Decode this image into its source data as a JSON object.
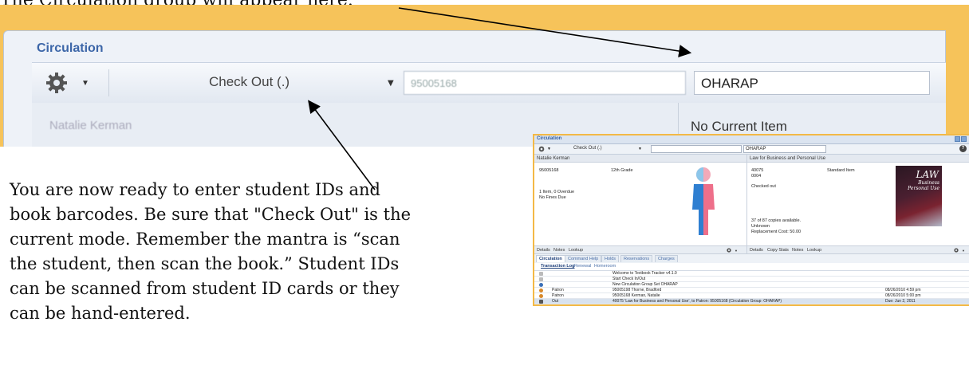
{
  "top_caption": "The Circulation group will appear here.",
  "zoom": {
    "title": "Circulation",
    "mode": "Check Out (.)",
    "barcode_value": "95005168",
    "group_value": "OHARAP",
    "patron_name": "Natalie Kerman",
    "current_item": "No Current Item"
  },
  "paragraph": [
    "You are now ready to enter student IDs and",
    "book barcodes.  Be sure that \"Check Out\" is the",
    "current mode. Remember the mantra is “scan",
    "the student, then  scan the book.” Student IDs",
    "can be scanned from student ID cards or they",
    "can be hand-entered."
  ],
  "shot": {
    "title": "Circulation",
    "mode": "Check Out (.)",
    "group_value": "OHARAP",
    "help": "?",
    "patron": {
      "name": "Natalie Kerman",
      "id": "95005168",
      "grade": "12th Grade",
      "items": "1 Item, 0 Overdue",
      "fines": "No Fines Due"
    },
    "item": {
      "title": "Law for Business and Personal Use",
      "number": "40075",
      "copy": "0004",
      "type": "Standard Item",
      "status": "Checked out",
      "copies": "37 of 87 copies available.",
      "location": "Unknown",
      "cost": "Replacement Cost: 50.00",
      "cover_title": "LAW",
      "cover_sub1": "Business",
      "cover_sub2": "Personal Use"
    },
    "patron_bar": [
      "Details",
      "Notes",
      "Lookup"
    ],
    "item_bar": [
      "Details",
      "Copy Stats",
      "Notes",
      "Lookup"
    ],
    "tabs": [
      "Circulation",
      "Command Help",
      "Holds",
      "Reservations",
      "Charges"
    ],
    "subtabs": [
      "Transaction Log",
      "Renewal",
      "Homeroom"
    ],
    "log": [
      {
        "type": "",
        "text": "Welcome to Textbook Tracker v4.1.0",
        "date": "",
        "icon": "note-icon"
      },
      {
        "type": "",
        "text": "Start Check In/Out",
        "date": "",
        "icon": "note-icon"
      },
      {
        "type": "",
        "text": "New Circulation Group Set OHARAP",
        "date": "",
        "icon": "refresh-icon"
      },
      {
        "type": "Patron",
        "text": "95005198 Thorne, Bradford",
        "date": "08/26/2010 4:59 pm",
        "icon": "patron-icon"
      },
      {
        "type": "Patron",
        "text": "95005168 Kerman, Natalie",
        "date": "08/26/2010 5:00 pm",
        "icon": "patron-icon"
      },
      {
        "type": "Out",
        "text": "40075 'Law for Business and Personal Use', to Patron: 95005168 (Circulation Group: OHARAP)",
        "date": "Due: Jun 2, 2011",
        "icon": "checkout-icon"
      }
    ]
  },
  "colors": {
    "highlight": "#f6c35a",
    "title_blue": "#3c66a8",
    "panel_bg": "#eef2f8",
    "frame_orange": "#f3b946"
  }
}
